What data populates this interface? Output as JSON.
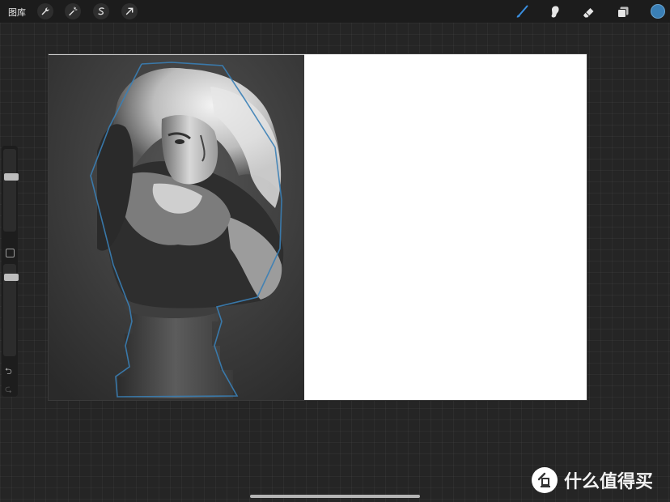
{
  "topbar": {
    "gallery_label": "图库",
    "left_tools": [
      "wrench-icon",
      "magic-wand-icon",
      "selection-icon",
      "transform-arrow-icon"
    ],
    "right_tools": [
      "brush-icon",
      "smudge-icon",
      "eraser-icon",
      "layers-icon"
    ],
    "active_tool": "brush-icon",
    "brush_color": "#3a7fb6",
    "current_color": "#3a7fb6"
  },
  "sidebar": {
    "size_slider_value": 0.25,
    "opacity_slider_value": 0.15
  },
  "canvas": {
    "background": "#ffffff",
    "reference": "sculpture-bust-photo",
    "sketch_stroke_color": "#3a7fb6"
  },
  "watermark": {
    "text": "什么值得买",
    "logo": "值"
  }
}
